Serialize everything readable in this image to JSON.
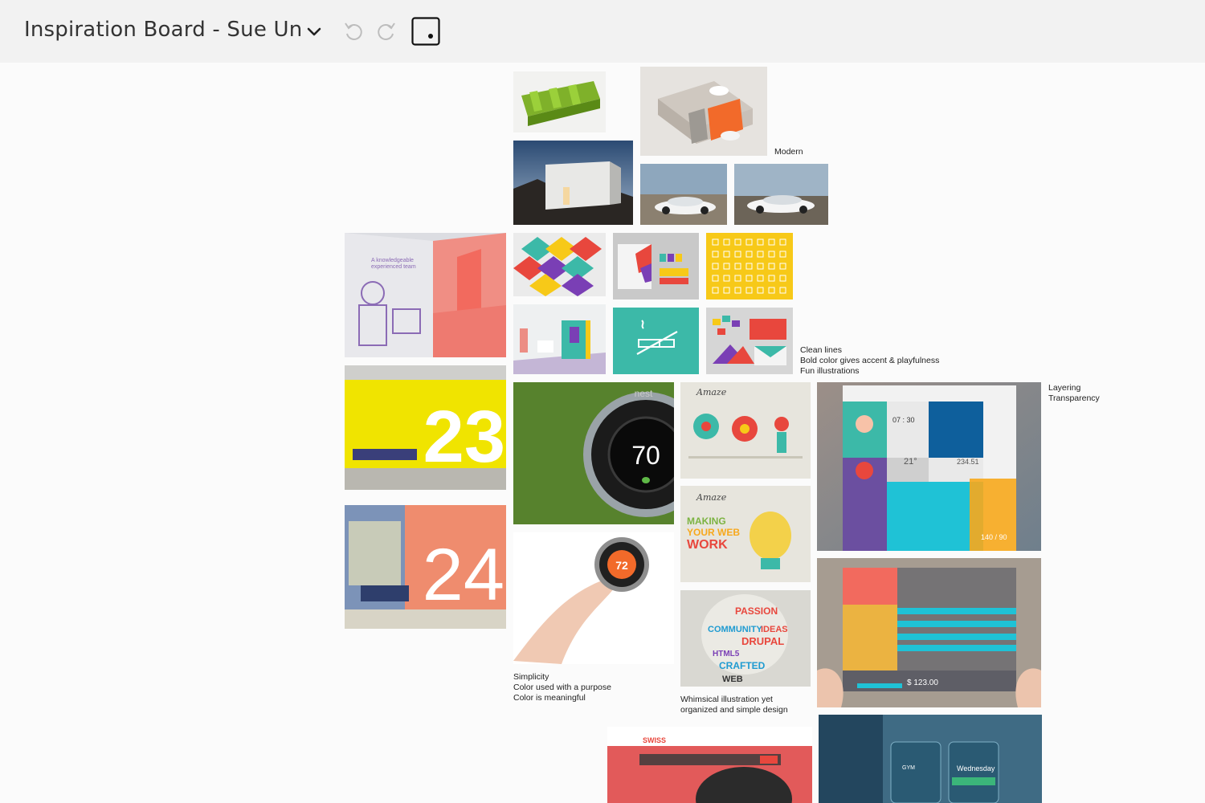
{
  "header": {
    "title": "Inspiration Board - Sue Un",
    "icons": [
      "chevron-down-icon",
      "undo-icon",
      "redo-icon",
      "frame-icon"
    ]
  },
  "notes": {
    "modern": [
      "Modern"
    ],
    "clean": [
      "Clean lines",
      "Bold color gives accent & playfulness",
      "Fun illustrations"
    ],
    "layering": [
      "Layering",
      "Transparency"
    ],
    "simplicity": [
      "Simplicity",
      "Color used with a purpose",
      "Color is meaningful"
    ],
    "whimsical": [
      "Whimsical illustration yet",
      "organized and simple design"
    ]
  },
  "images": {
    "nest_display": "70",
    "nest_hand_display": "72",
    "nest_brand": "nest",
    "gate_23": "23",
    "gate_24": "24",
    "signage_text": [
      "A knowledgeable",
      "experienced team"
    ],
    "amaze_words": [
      "MAKING",
      "YOUR WEB",
      "WORK"
    ],
    "word_cloud": [
      "PASSION",
      "COMMUNITY",
      "IDEAS",
      "DRUPAL",
      "HTML5",
      "CRAFTED",
      "WEB"
    ],
    "app_time": "07 : 30",
    "app_temp": "21°",
    "app_value": "234.51",
    "app_bp": "140 / 90",
    "price": "$ 123.00",
    "swiss_brand": "SWISS",
    "weekday": "Wednesday",
    "gym_label": "GYM"
  },
  "colors": {
    "accent_orange": "#f26a2a",
    "teal": "#3cb9a8",
    "yellow": "#f7c918",
    "cyan": "#1fc2d6"
  }
}
